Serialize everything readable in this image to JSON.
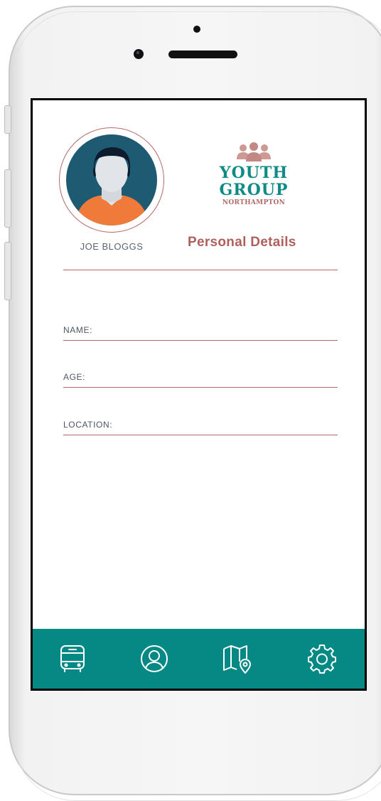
{
  "profile": {
    "name": "JOE BLOGGS"
  },
  "logo": {
    "line1": "YOUTH",
    "line2": "GROUP",
    "line3": "NORTHAMPTON"
  },
  "page": {
    "title": "Personal Details"
  },
  "form": {
    "fields": [
      {
        "label": "NAME:"
      },
      {
        "label": "AGE:"
      },
      {
        "label": "LOCATION:"
      }
    ]
  },
  "tabbar": {
    "background": "#068984",
    "icons": [
      "bus-icon",
      "user-icon",
      "map-icon",
      "settings-icon"
    ]
  },
  "colors": {
    "accent": "#b0605c",
    "brand": "#0f8a84",
    "avatar_bg": "#1f5a73",
    "shirt": "#f07a3a"
  }
}
